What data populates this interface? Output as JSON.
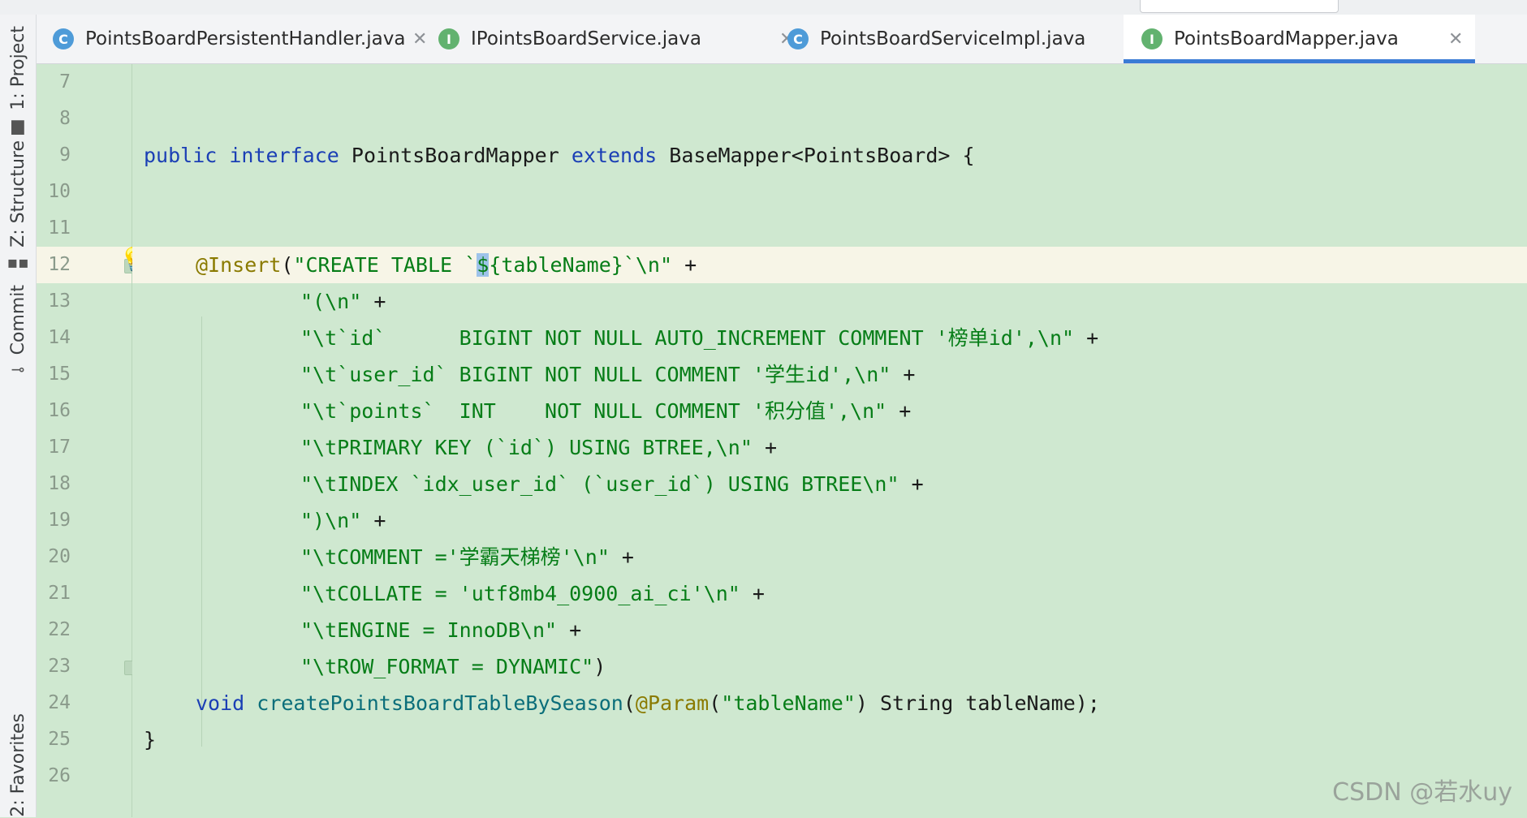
{
  "tabs": [
    {
      "label": "PointsBoardPersistentHandler.java",
      "kind": "C",
      "active": false
    },
    {
      "label": "IPointsBoardService.java",
      "kind": "I",
      "active": false
    },
    {
      "label": "PointsBoardServiceImpl.java",
      "kind": "C",
      "active": false
    },
    {
      "label": "PointsBoardMapper.java",
      "kind": "I",
      "active": true
    }
  ],
  "tool_stripe": [
    {
      "label": "1: Project",
      "icon": "folder-icon"
    },
    {
      "label": "Z: Structure",
      "icon": "structure-icon"
    },
    {
      "label": "Commit",
      "icon": "commit-icon"
    },
    {
      "label": "2: Favorites",
      "icon": "star-icon"
    }
  ],
  "line_numbers": [
    "7",
    "8",
    "9",
    "10",
    "11",
    "12",
    "13",
    "14",
    "15",
    "16",
    "17",
    "18",
    "19",
    "20",
    "21",
    "22",
    "23",
    "24",
    "25",
    "26"
  ],
  "code": {
    "l9": {
      "kw1": "public",
      "kw2": "interface",
      "name": "PointsBoardMapper",
      "kw3": "extends",
      "rest": "BaseMapper<PointsBoard> {"
    },
    "l12": {
      "ann": "@Insert",
      "p1": "(",
      "s1": "\"CREATE TABLE `",
      "sel": "$",
      "s2": "{tableName}`\\n\"",
      "op": " +"
    },
    "l13": {
      "s": "\"(\\n\"",
      "op": " +"
    },
    "l14": {
      "s": "\"\\t`id`      BIGINT NOT NULL AUTO_INCREMENT COMMENT '榜单id',\\n\"",
      "op": " +"
    },
    "l15": {
      "s": "\"\\t`user_id` BIGINT NOT NULL COMMENT '学生id',\\n\"",
      "op": " +"
    },
    "l16": {
      "s": "\"\\t`points`  INT    NOT NULL COMMENT '积分值',\\n\"",
      "op": " +"
    },
    "l17": {
      "s": "\"\\tPRIMARY KEY (`id`) USING BTREE,\\n\"",
      "op": " +"
    },
    "l18": {
      "s": "\"\\tINDEX `idx_user_id` (`user_id`) USING BTREE\\n\"",
      "op": " +"
    },
    "l19": {
      "s": "\")\\n\"",
      "op": " +"
    },
    "l20": {
      "s": "\"\\tCOMMENT ='学霸天梯榜'\\n\"",
      "op": " +"
    },
    "l21": {
      "s": "\"\\tCOLLATE = 'utf8mb4_0900_ai_ci'\\n\"",
      "op": " +"
    },
    "l22": {
      "s": "\"\\tENGINE = InnoDB\\n\"",
      "op": " +"
    },
    "l23": {
      "s": "\"\\tROW_FORMAT = DYNAMIC\"",
      "op": ")"
    },
    "l24": {
      "kw": "void",
      "fn": "createPointsBoardTableBySeason",
      "p1": "(",
      "ann": "@Param",
      "p2": "(",
      "s": "\"tableName\"",
      "rest": ") String tableName);"
    },
    "l25": {
      "brace": "}"
    }
  },
  "watermark": "CSDN @若水uy",
  "colors": {
    "editor_bg": "#cfe8d0",
    "keyword": "#1b3fb5",
    "string": "#067d17",
    "annotation": "#8a7a00",
    "accent": "#3a7bd5"
  }
}
